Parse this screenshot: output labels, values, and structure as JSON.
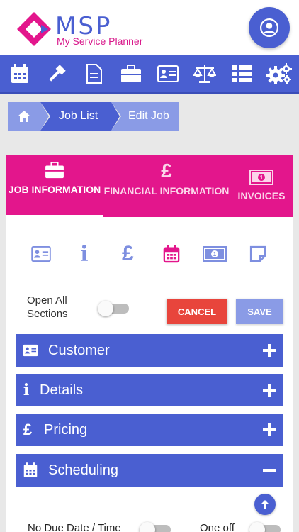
{
  "brand": {
    "title": "MSP",
    "subtitle": "My Service Planner",
    "primary_color": "#4a5fd1",
    "accent_color": "#e3168c"
  },
  "header": {
    "avatar_icon": "user-icon"
  },
  "topnav": {
    "items": [
      {
        "icon": "calendar-icon"
      },
      {
        "icon": "gavel-icon"
      },
      {
        "icon": "document-icon"
      },
      {
        "icon": "briefcase-icon"
      },
      {
        "icon": "id-card-icon"
      },
      {
        "icon": "scales-icon"
      },
      {
        "icon": "list-icon"
      },
      {
        "icon": "gears-icon"
      }
    ]
  },
  "breadcrumb": {
    "home_icon": "home-icon",
    "items": [
      "Job List",
      "Edit Job"
    ]
  },
  "tabs": [
    {
      "label": "JOB INFORMATION",
      "icon": "briefcase-icon",
      "active": true
    },
    {
      "label": "FINANCIAL INFORMATION",
      "icon": "pound-icon",
      "active": false
    },
    {
      "label": "INVOICES",
      "icon": "banknote-icon",
      "active": false
    }
  ],
  "subnav": {
    "icons": [
      "id-card-icon",
      "info-icon",
      "pound-icon",
      "calendar-icon",
      "banknote-icon",
      "note-icon"
    ],
    "active_index": 3
  },
  "controls": {
    "open_all_label": "Open All Sections",
    "open_all_line1": "Open All",
    "open_all_line2": "Sections",
    "cancel_label": "CANCEL",
    "save_label": "SAVE"
  },
  "sections": [
    {
      "label": "Customer",
      "expanded": false
    },
    {
      "label": "Details",
      "expanded": false
    },
    {
      "label": "Pricing",
      "expanded": false
    },
    {
      "label": "Scheduling",
      "expanded": true
    }
  ],
  "scheduling": {
    "no_due_label": "No Due Date / Time",
    "one_off_label": "One off"
  }
}
